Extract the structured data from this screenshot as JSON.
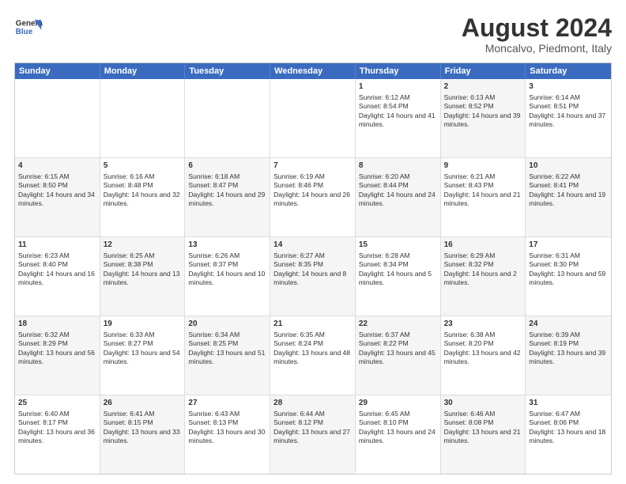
{
  "header": {
    "logo_line1": "General",
    "logo_line2": "Blue",
    "title": "August 2024",
    "subtitle": "Moncalvo, Piedmont, Italy"
  },
  "weekdays": [
    "Sunday",
    "Monday",
    "Tuesday",
    "Wednesday",
    "Thursday",
    "Friday",
    "Saturday"
  ],
  "rows": [
    [
      {
        "day": "",
        "text": "",
        "alt": false
      },
      {
        "day": "",
        "text": "",
        "alt": false
      },
      {
        "day": "",
        "text": "",
        "alt": false
      },
      {
        "day": "",
        "text": "",
        "alt": false
      },
      {
        "day": "1",
        "text": "Sunrise: 6:12 AM\nSunset: 8:54 PM\nDaylight: 14 hours and 41 minutes.",
        "alt": false
      },
      {
        "day": "2",
        "text": "Sunrise: 6:13 AM\nSunset: 8:52 PM\nDaylight: 14 hours and 39 minutes.",
        "alt": true
      },
      {
        "day": "3",
        "text": "Sunrise: 6:14 AM\nSunset: 8:51 PM\nDaylight: 14 hours and 37 minutes.",
        "alt": false
      }
    ],
    [
      {
        "day": "4",
        "text": "Sunrise: 6:15 AM\nSunset: 8:50 PM\nDaylight: 14 hours and 34 minutes.",
        "alt": true
      },
      {
        "day": "5",
        "text": "Sunrise: 6:16 AM\nSunset: 8:48 PM\nDaylight: 14 hours and 32 minutes.",
        "alt": false
      },
      {
        "day": "6",
        "text": "Sunrise: 6:18 AM\nSunset: 8:47 PM\nDaylight: 14 hours and 29 minutes.",
        "alt": true
      },
      {
        "day": "7",
        "text": "Sunrise: 6:19 AM\nSunset: 8:46 PM\nDaylight: 14 hours and 26 minutes.",
        "alt": false
      },
      {
        "day": "8",
        "text": "Sunrise: 6:20 AM\nSunset: 8:44 PM\nDaylight: 14 hours and 24 minutes.",
        "alt": true
      },
      {
        "day": "9",
        "text": "Sunrise: 6:21 AM\nSunset: 8:43 PM\nDaylight: 14 hours and 21 minutes.",
        "alt": false
      },
      {
        "day": "10",
        "text": "Sunrise: 6:22 AM\nSunset: 8:41 PM\nDaylight: 14 hours and 19 minutes.",
        "alt": true
      }
    ],
    [
      {
        "day": "11",
        "text": "Sunrise: 6:23 AM\nSunset: 8:40 PM\nDaylight: 14 hours and 16 minutes.",
        "alt": false
      },
      {
        "day": "12",
        "text": "Sunrise: 6:25 AM\nSunset: 8:38 PM\nDaylight: 14 hours and 13 minutes.",
        "alt": true
      },
      {
        "day": "13",
        "text": "Sunrise: 6:26 AM\nSunset: 8:37 PM\nDaylight: 14 hours and 10 minutes.",
        "alt": false
      },
      {
        "day": "14",
        "text": "Sunrise: 6:27 AM\nSunset: 8:35 PM\nDaylight: 14 hours and 8 minutes.",
        "alt": true
      },
      {
        "day": "15",
        "text": "Sunrise: 6:28 AM\nSunset: 8:34 PM\nDaylight: 14 hours and 5 minutes.",
        "alt": false
      },
      {
        "day": "16",
        "text": "Sunrise: 6:29 AM\nSunset: 8:32 PM\nDaylight: 14 hours and 2 minutes.",
        "alt": true
      },
      {
        "day": "17",
        "text": "Sunrise: 6:31 AM\nSunset: 8:30 PM\nDaylight: 13 hours and 59 minutes.",
        "alt": false
      }
    ],
    [
      {
        "day": "18",
        "text": "Sunrise: 6:32 AM\nSunset: 8:29 PM\nDaylight: 13 hours and 56 minutes.",
        "alt": true
      },
      {
        "day": "19",
        "text": "Sunrise: 6:33 AM\nSunset: 8:27 PM\nDaylight: 13 hours and 54 minutes.",
        "alt": false
      },
      {
        "day": "20",
        "text": "Sunrise: 6:34 AM\nSunset: 8:25 PM\nDaylight: 13 hours and 51 minutes.",
        "alt": true
      },
      {
        "day": "21",
        "text": "Sunrise: 6:35 AM\nSunset: 8:24 PM\nDaylight: 13 hours and 48 minutes.",
        "alt": false
      },
      {
        "day": "22",
        "text": "Sunrise: 6:37 AM\nSunset: 8:22 PM\nDaylight: 13 hours and 45 minutes.",
        "alt": true
      },
      {
        "day": "23",
        "text": "Sunrise: 6:38 AM\nSunset: 8:20 PM\nDaylight: 13 hours and 42 minutes.",
        "alt": false
      },
      {
        "day": "24",
        "text": "Sunrise: 6:39 AM\nSunset: 8:19 PM\nDaylight: 13 hours and 39 minutes.",
        "alt": true
      }
    ],
    [
      {
        "day": "25",
        "text": "Sunrise: 6:40 AM\nSunset: 8:17 PM\nDaylight: 13 hours and 36 minutes.",
        "alt": false
      },
      {
        "day": "26",
        "text": "Sunrise: 6:41 AM\nSunset: 8:15 PM\nDaylight: 13 hours and 33 minutes.",
        "alt": true
      },
      {
        "day": "27",
        "text": "Sunrise: 6:43 AM\nSunset: 8:13 PM\nDaylight: 13 hours and 30 minutes.",
        "alt": false
      },
      {
        "day": "28",
        "text": "Sunrise: 6:44 AM\nSunset: 8:12 PM\nDaylight: 13 hours and 27 minutes.",
        "alt": true
      },
      {
        "day": "29",
        "text": "Sunrise: 6:45 AM\nSunset: 8:10 PM\nDaylight: 13 hours and 24 minutes.",
        "alt": false
      },
      {
        "day": "30",
        "text": "Sunrise: 6:46 AM\nSunset: 8:08 PM\nDaylight: 13 hours and 21 minutes.",
        "alt": true
      },
      {
        "day": "31",
        "text": "Sunrise: 6:47 AM\nSunset: 8:06 PM\nDaylight: 13 hours and 18 minutes.",
        "alt": false
      }
    ]
  ]
}
